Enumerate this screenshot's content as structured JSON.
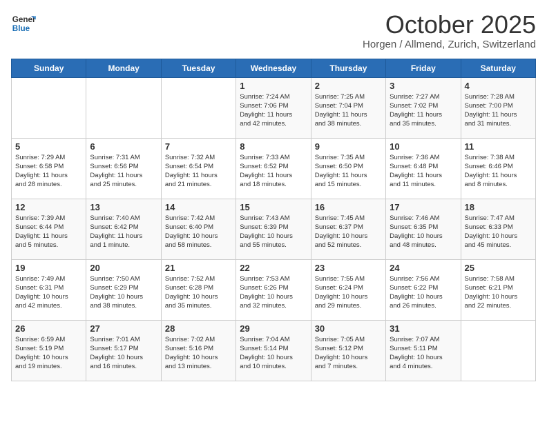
{
  "header": {
    "logo_line1": "General",
    "logo_line2": "Blue",
    "month": "October 2025",
    "location": "Horgen / Allmend, Zurich, Switzerland"
  },
  "days_of_week": [
    "Sunday",
    "Monday",
    "Tuesday",
    "Wednesday",
    "Thursday",
    "Friday",
    "Saturday"
  ],
  "weeks": [
    [
      {
        "day": "",
        "info": ""
      },
      {
        "day": "",
        "info": ""
      },
      {
        "day": "",
        "info": ""
      },
      {
        "day": "1",
        "info": "Sunrise: 7:24 AM\nSunset: 7:06 PM\nDaylight: 11 hours\nand 42 minutes."
      },
      {
        "day": "2",
        "info": "Sunrise: 7:25 AM\nSunset: 7:04 PM\nDaylight: 11 hours\nand 38 minutes."
      },
      {
        "day": "3",
        "info": "Sunrise: 7:27 AM\nSunset: 7:02 PM\nDaylight: 11 hours\nand 35 minutes."
      },
      {
        "day": "4",
        "info": "Sunrise: 7:28 AM\nSunset: 7:00 PM\nDaylight: 11 hours\nand 31 minutes."
      }
    ],
    [
      {
        "day": "5",
        "info": "Sunrise: 7:29 AM\nSunset: 6:58 PM\nDaylight: 11 hours\nand 28 minutes."
      },
      {
        "day": "6",
        "info": "Sunrise: 7:31 AM\nSunset: 6:56 PM\nDaylight: 11 hours\nand 25 minutes."
      },
      {
        "day": "7",
        "info": "Sunrise: 7:32 AM\nSunset: 6:54 PM\nDaylight: 11 hours\nand 21 minutes."
      },
      {
        "day": "8",
        "info": "Sunrise: 7:33 AM\nSunset: 6:52 PM\nDaylight: 11 hours\nand 18 minutes."
      },
      {
        "day": "9",
        "info": "Sunrise: 7:35 AM\nSunset: 6:50 PM\nDaylight: 11 hours\nand 15 minutes."
      },
      {
        "day": "10",
        "info": "Sunrise: 7:36 AM\nSunset: 6:48 PM\nDaylight: 11 hours\nand 11 minutes."
      },
      {
        "day": "11",
        "info": "Sunrise: 7:38 AM\nSunset: 6:46 PM\nDaylight: 11 hours\nand 8 minutes."
      }
    ],
    [
      {
        "day": "12",
        "info": "Sunrise: 7:39 AM\nSunset: 6:44 PM\nDaylight: 11 hours\nand 5 minutes."
      },
      {
        "day": "13",
        "info": "Sunrise: 7:40 AM\nSunset: 6:42 PM\nDaylight: 11 hours\nand 1 minute."
      },
      {
        "day": "14",
        "info": "Sunrise: 7:42 AM\nSunset: 6:40 PM\nDaylight: 10 hours\nand 58 minutes."
      },
      {
        "day": "15",
        "info": "Sunrise: 7:43 AM\nSunset: 6:39 PM\nDaylight: 10 hours\nand 55 minutes."
      },
      {
        "day": "16",
        "info": "Sunrise: 7:45 AM\nSunset: 6:37 PM\nDaylight: 10 hours\nand 52 minutes."
      },
      {
        "day": "17",
        "info": "Sunrise: 7:46 AM\nSunset: 6:35 PM\nDaylight: 10 hours\nand 48 minutes."
      },
      {
        "day": "18",
        "info": "Sunrise: 7:47 AM\nSunset: 6:33 PM\nDaylight: 10 hours\nand 45 minutes."
      }
    ],
    [
      {
        "day": "19",
        "info": "Sunrise: 7:49 AM\nSunset: 6:31 PM\nDaylight: 10 hours\nand 42 minutes."
      },
      {
        "day": "20",
        "info": "Sunrise: 7:50 AM\nSunset: 6:29 PM\nDaylight: 10 hours\nand 38 minutes."
      },
      {
        "day": "21",
        "info": "Sunrise: 7:52 AM\nSunset: 6:28 PM\nDaylight: 10 hours\nand 35 minutes."
      },
      {
        "day": "22",
        "info": "Sunrise: 7:53 AM\nSunset: 6:26 PM\nDaylight: 10 hours\nand 32 minutes."
      },
      {
        "day": "23",
        "info": "Sunrise: 7:55 AM\nSunset: 6:24 PM\nDaylight: 10 hours\nand 29 minutes."
      },
      {
        "day": "24",
        "info": "Sunrise: 7:56 AM\nSunset: 6:22 PM\nDaylight: 10 hours\nand 26 minutes."
      },
      {
        "day": "25",
        "info": "Sunrise: 7:58 AM\nSunset: 6:21 PM\nDaylight: 10 hours\nand 22 minutes."
      }
    ],
    [
      {
        "day": "26",
        "info": "Sunrise: 6:59 AM\nSunset: 5:19 PM\nDaylight: 10 hours\nand 19 minutes."
      },
      {
        "day": "27",
        "info": "Sunrise: 7:01 AM\nSunset: 5:17 PM\nDaylight: 10 hours\nand 16 minutes."
      },
      {
        "day": "28",
        "info": "Sunrise: 7:02 AM\nSunset: 5:16 PM\nDaylight: 10 hours\nand 13 minutes."
      },
      {
        "day": "29",
        "info": "Sunrise: 7:04 AM\nSunset: 5:14 PM\nDaylight: 10 hours\nand 10 minutes."
      },
      {
        "day": "30",
        "info": "Sunrise: 7:05 AM\nSunset: 5:12 PM\nDaylight: 10 hours\nand 7 minutes."
      },
      {
        "day": "31",
        "info": "Sunrise: 7:07 AM\nSunset: 5:11 PM\nDaylight: 10 hours\nand 4 minutes."
      },
      {
        "day": "",
        "info": ""
      }
    ]
  ]
}
